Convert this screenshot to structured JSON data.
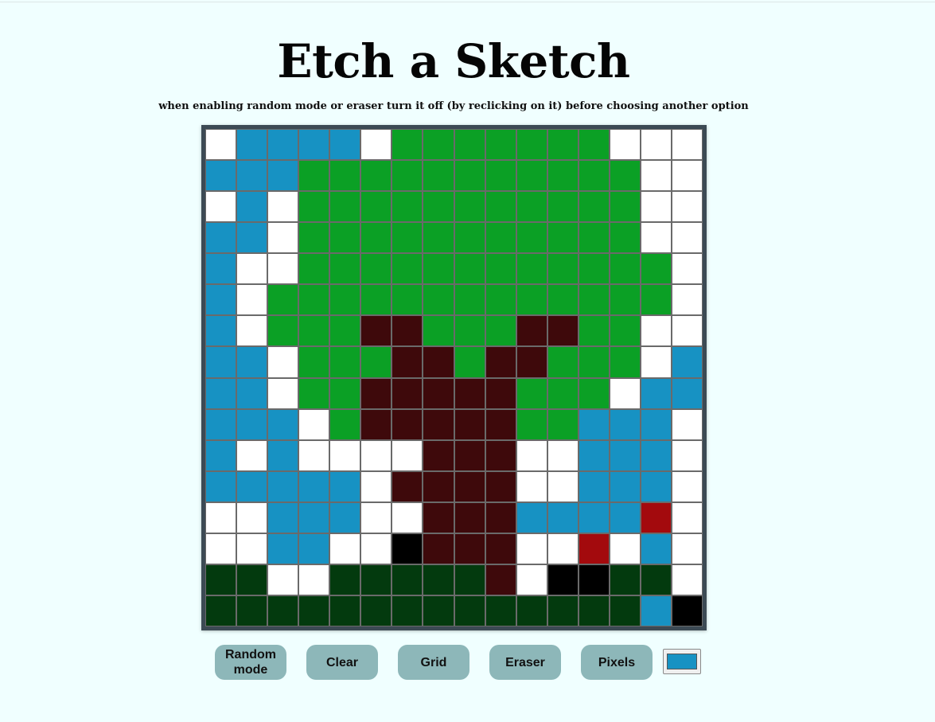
{
  "title": "Etch a Sketch",
  "subtitle": "when enabling random mode or eraser turn it off (by reclicking on it) before choosing another option",
  "palette": {
    "W": "#ffffff",
    "B": "#1792c3",
    "G": "#0ba025",
    "T": "#3e090b",
    "D": "#033a0e",
    "R": "#a30a0d",
    "K": "#000000"
  },
  "grid": [
    "WBBBBWGGGGGGGWWW",
    "BBBGGGGGGGGGGGWW",
    "WBWGGGGGGGGGGGWW",
    "BBWGGGGGGGGGGGWW",
    "BWWGGGGGGGGGGGGW",
    "BWGGGGGGGGGGGGGW",
    "BWGGGTTGGGTTGGWW",
    "BBWGGGTTGTTGGGWB",
    "BBWGGTTTTTGGGWBB",
    "BBBWGTTTTTGGBBBW",
    "BWBWWWWTTTWWBBBW",
    "BBBBBWTTTTWWBBBW",
    "WWBBBWWTTTBBBBRW",
    "WWBBWWKTTTWWRWBW",
    "DDWWDDDDDTWKKDDW",
    "DDDDDDDDDDDDDDBK"
  ],
  "controls": {
    "random_label": "Random mode",
    "clear_label": "Clear",
    "grid_label": "Grid",
    "eraser_label": "Eraser",
    "pixels_label": "Pixels",
    "color_value": "#1792c3"
  }
}
